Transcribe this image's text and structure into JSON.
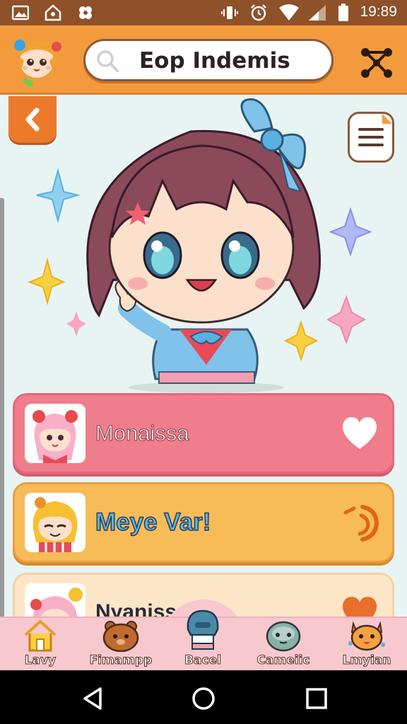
{
  "status_bar": {
    "time": "19:89",
    "left_icons": [
      "image-icon",
      "home-icon",
      "settings-icon"
    ],
    "right_icons": [
      "vibrate-icon",
      "alarm-icon",
      "wifi-icon",
      "signal-icon",
      "battery-icon"
    ]
  },
  "header": {
    "avatar_icon": "chibi-avatar-icon",
    "search_text": "Eop Indemis",
    "share_icon": "share-icon"
  },
  "content": {
    "back_icon": "chevron-left-icon",
    "menu_icon": "menu-icon"
  },
  "cards": [
    {
      "title": "Monaissa",
      "action_icon": "heart-icon"
    },
    {
      "title": "Meye Var!",
      "action_icon": "refresh-icon"
    },
    {
      "title": "Nyanissa",
      "action_icon": "heart-icon"
    }
  ],
  "tabs": [
    {
      "label": "Lavy",
      "icon": "house-icon"
    },
    {
      "label": "Fimampp",
      "icon": "bear-icon"
    },
    {
      "label": "Bacel",
      "icon": "robot-icon"
    },
    {
      "label": "Cameiic",
      "icon": "blob-icon"
    },
    {
      "label": "Lmyian",
      "icon": "fox-icon"
    }
  ],
  "colors": {
    "header": "#f39b3c",
    "status_bar": "#8e5129",
    "card_pink": "#f07d8b",
    "card_orange": "#f7bb58",
    "card_cream": "#fde6c8",
    "tabbar": "#f8c8cf"
  }
}
